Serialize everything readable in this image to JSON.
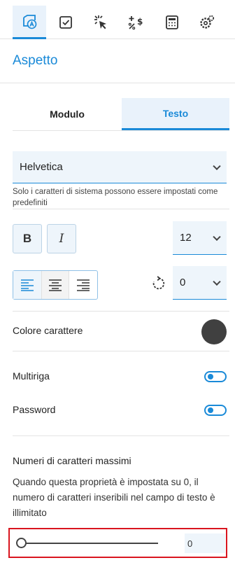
{
  "toolbar": {
    "tabs": [
      {
        "icon": "appearance-icon",
        "active": true
      },
      {
        "icon": "checkbox-icon",
        "active": false
      },
      {
        "icon": "cursor-click-icon",
        "active": false
      },
      {
        "icon": "calculate-currency-icon",
        "active": false
      },
      {
        "icon": "calculator-icon",
        "active": false
      },
      {
        "icon": "settings-icon",
        "active": false
      }
    ]
  },
  "panel": {
    "title": "Aspetto"
  },
  "tabs": {
    "modulo": "Modulo",
    "testo": "Testo",
    "active": "Testo"
  },
  "font": {
    "family_value": "Helvetica",
    "hint": "Solo i caratteri di sistema possono essere impostati come predefiniti"
  },
  "style": {
    "bold_label": "B",
    "italic_label": "I",
    "size_value": "12"
  },
  "alignment": {
    "selected": "left",
    "rotation_value": "0"
  },
  "color": {
    "label": "Colore carattere",
    "value": "#404040"
  },
  "options": {
    "multiline_label": "Multiriga",
    "multiline_on": true,
    "password_label": "Password",
    "password_on": true
  },
  "max_chars": {
    "heading": "Numeri di caratteri massimi",
    "description": "Quando questa proprietà è impostata su 0, il numero di caratteri inseribili nel campo di testo è illimitato",
    "value": "0"
  },
  "accent_color": "#1a8ad8",
  "highlight_color": "#d9151f"
}
